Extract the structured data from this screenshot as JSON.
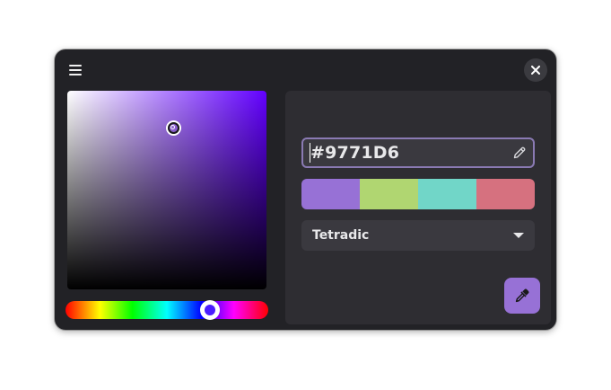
{
  "header": {
    "menu_icon": "hamburger-menu-icon",
    "close_icon": "close-icon"
  },
  "picker": {
    "current_color": "#9771D6",
    "hue_color": "#6200ff"
  },
  "hex_field": {
    "value": "#9771D6",
    "edit_icon": "pencil-icon"
  },
  "palette": {
    "swatches": [
      {
        "color": "#9771d6"
      },
      {
        "color": "#b0d671"
      },
      {
        "color": "#71d6c8"
      },
      {
        "color": "#d6717f"
      }
    ]
  },
  "harmony": {
    "selected": "Tetradic"
  },
  "eyedropper": {
    "icon": "eyedropper-icon",
    "accent": "#9771d6"
  }
}
